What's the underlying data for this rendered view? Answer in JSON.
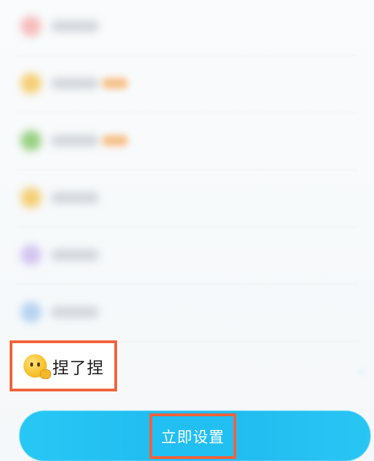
{
  "highlighted_item": {
    "emoji": "face-with-hand-emoji",
    "label": "捏了捏"
  },
  "blurred_items": [
    {
      "emoji_color": "#f7a7a7",
      "has_tag": false
    },
    {
      "emoji_color": "#f5c048",
      "has_tag": true
    },
    {
      "emoji_color": "#78c35a",
      "has_tag": true
    },
    {
      "emoji_color": "#f5c048",
      "has_tag": false
    },
    {
      "emoji_color": "#c7b4ef",
      "has_tag": false
    },
    {
      "emoji_color": "#9fc6ec",
      "has_tag": false
    }
  ],
  "action": {
    "button_label": "立即设置"
  },
  "colors": {
    "highlight_border": "#f2613a",
    "accent": "#22bff2"
  }
}
